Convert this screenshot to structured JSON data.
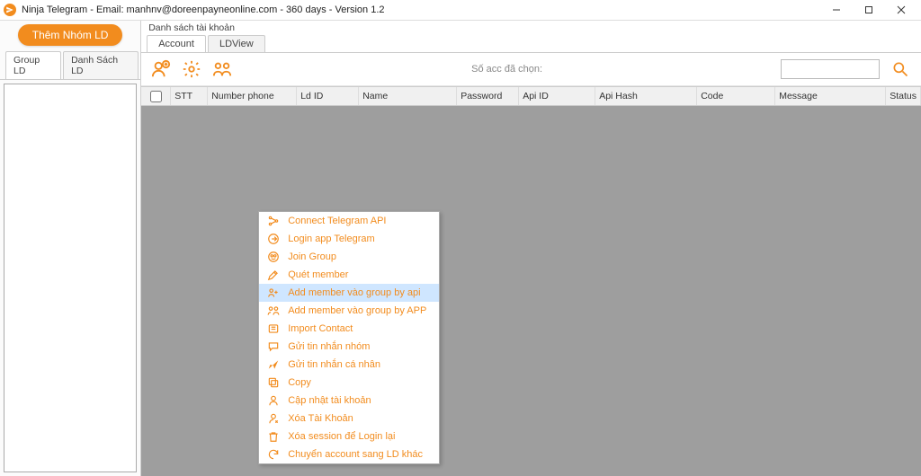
{
  "titlebar": {
    "title": "Ninja Telegram - Email: manhnv@doreenpayneonline.com - 360 days - Version 1.2"
  },
  "sidebar": {
    "primary_button": "Thêm Nhóm LD",
    "tabs": [
      "Group LD",
      "Danh Sách LD"
    ]
  },
  "main": {
    "section_title": "Danh sách tài khoản",
    "tabs": [
      "Account",
      "LDView"
    ],
    "toolbar_center": "Số acc đã chọn:",
    "search_placeholder": ""
  },
  "columns": {
    "stt": "STT",
    "phone": "Number phone",
    "ldid": "Ld ID",
    "name": "Name",
    "pwd": "Password",
    "apiid": "Api ID",
    "hash": "Api Hash",
    "code": "Code",
    "msg": "Message",
    "status": "Status"
  },
  "context_menu": [
    "Connect Telegram API",
    "Login app Telegram",
    "Join Group",
    "Quét member",
    "Add member vào group by api",
    "Add member vào group by APP",
    "Import Contact",
    "Gửi tin nhắn nhóm",
    "Gửi tin nhắn cá nhân",
    "Copy",
    "Cập nhật tài khoản",
    "Xóa Tài Khoản",
    "Xóa session để Login lại",
    "Chuyển account sang LD khác"
  ],
  "context_highlight_index": 4
}
